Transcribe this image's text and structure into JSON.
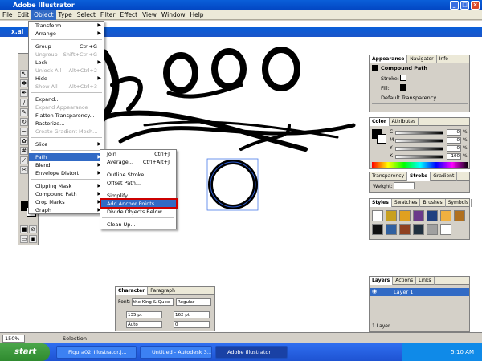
{
  "app": {
    "title": "Adobe Illustrator"
  },
  "menubar": [
    "File",
    "Edit",
    "Object",
    "Type",
    "Select",
    "Filter",
    "Effect",
    "View",
    "Window",
    "Help"
  ],
  "document": {
    "title": "x.ai"
  },
  "object_menu": [
    {
      "label": "Transform",
      "arrow": true
    },
    {
      "label": "Arrange",
      "arrow": true
    },
    {
      "sep": true
    },
    {
      "label": "Group",
      "shortcut": "Ctrl+G"
    },
    {
      "label": "Ungroup",
      "shortcut": "Shift+Ctrl+G",
      "disabled": true
    },
    {
      "label": "Lock",
      "arrow": true
    },
    {
      "label": "Unlock All",
      "shortcut": "Alt+Ctrl+2",
      "disabled": true
    },
    {
      "label": "Hide",
      "arrow": true
    },
    {
      "label": "Show All",
      "shortcut": "Alt+Ctrl+3",
      "disabled": true
    },
    {
      "sep": true
    },
    {
      "label": "Expand..."
    },
    {
      "label": "Expand Appearance",
      "disabled": true
    },
    {
      "label": "Flatten Transparency..."
    },
    {
      "label": "Rasterize..."
    },
    {
      "label": "Create Gradient Mesh...",
      "disabled": true
    },
    {
      "sep": true
    },
    {
      "label": "Slice",
      "arrow": true
    },
    {
      "sep": true
    },
    {
      "label": "Path",
      "arrow": true,
      "highlight": true
    },
    {
      "label": "Blend",
      "arrow": true
    },
    {
      "label": "Envelope Distort",
      "arrow": true
    },
    {
      "sep": true
    },
    {
      "label": "Clipping Mask",
      "arrow": true
    },
    {
      "label": "Compound Path",
      "arrow": true
    },
    {
      "label": "Crop Marks",
      "arrow": true
    },
    {
      "label": "Graph",
      "arrow": true
    }
  ],
  "path_menu": [
    {
      "label": "Join",
      "shortcut": "Ctrl+J"
    },
    {
      "label": "Average...",
      "shortcut": "Ctrl+Alt+J"
    },
    {
      "sep": true
    },
    {
      "label": "Outline Stroke"
    },
    {
      "label": "Offset Path..."
    },
    {
      "sep": true
    },
    {
      "label": "Simplify..."
    },
    {
      "label": "Add Anchor Points",
      "highlight": true
    },
    {
      "label": "Divide Objects Below"
    },
    {
      "sep": true
    },
    {
      "label": "Clean Up..."
    }
  ],
  "appearance": {
    "tabs": [
      "Appearance",
      "Navigator",
      "Info"
    ],
    "item": "Compound Path",
    "stroke_label": "Stroke:",
    "fill_label": "Fill:",
    "transparency_label": "Default Transparency"
  },
  "color": {
    "tabs": [
      "Color",
      "Attributes"
    ],
    "channels": [
      "C",
      "M",
      "Y",
      "K"
    ],
    "values": [
      "0",
      "0",
      "0",
      "100"
    ],
    "unit": "%"
  },
  "stroke": {
    "tabs": [
      "Transparency",
      "Stroke",
      "Gradient"
    ],
    "weight_label": "Weight:"
  },
  "styles": {
    "tabs": [
      "Styles",
      "Swatches",
      "Brushes",
      "Symbols"
    ]
  },
  "layers": {
    "tabs": [
      "Layers",
      "Actions",
      "Links"
    ],
    "layer_name": "Layer 1",
    "count": "1 Layer"
  },
  "character": {
    "tabs": [
      "Character",
      "Paragraph"
    ],
    "font_label": "Font:",
    "font": "the King & Quee",
    "style": "Regular",
    "size": "135 pt",
    "leading": "162 pt",
    "tracking": "Auto",
    "kerning": "0"
  },
  "status": {
    "zoom": "150%",
    "mode": "Selection"
  },
  "taskbar": {
    "start": "start",
    "tasks": [
      "Figura02_Illustrator.j...",
      "Untitled - Autodesk 3...",
      "Adobe Illustrator"
    ],
    "clock": "5:10 AM"
  },
  "colors": {
    "accent": "#316ac5",
    "title": "#0a5fd9",
    "highlight_box": "#cc0000"
  }
}
